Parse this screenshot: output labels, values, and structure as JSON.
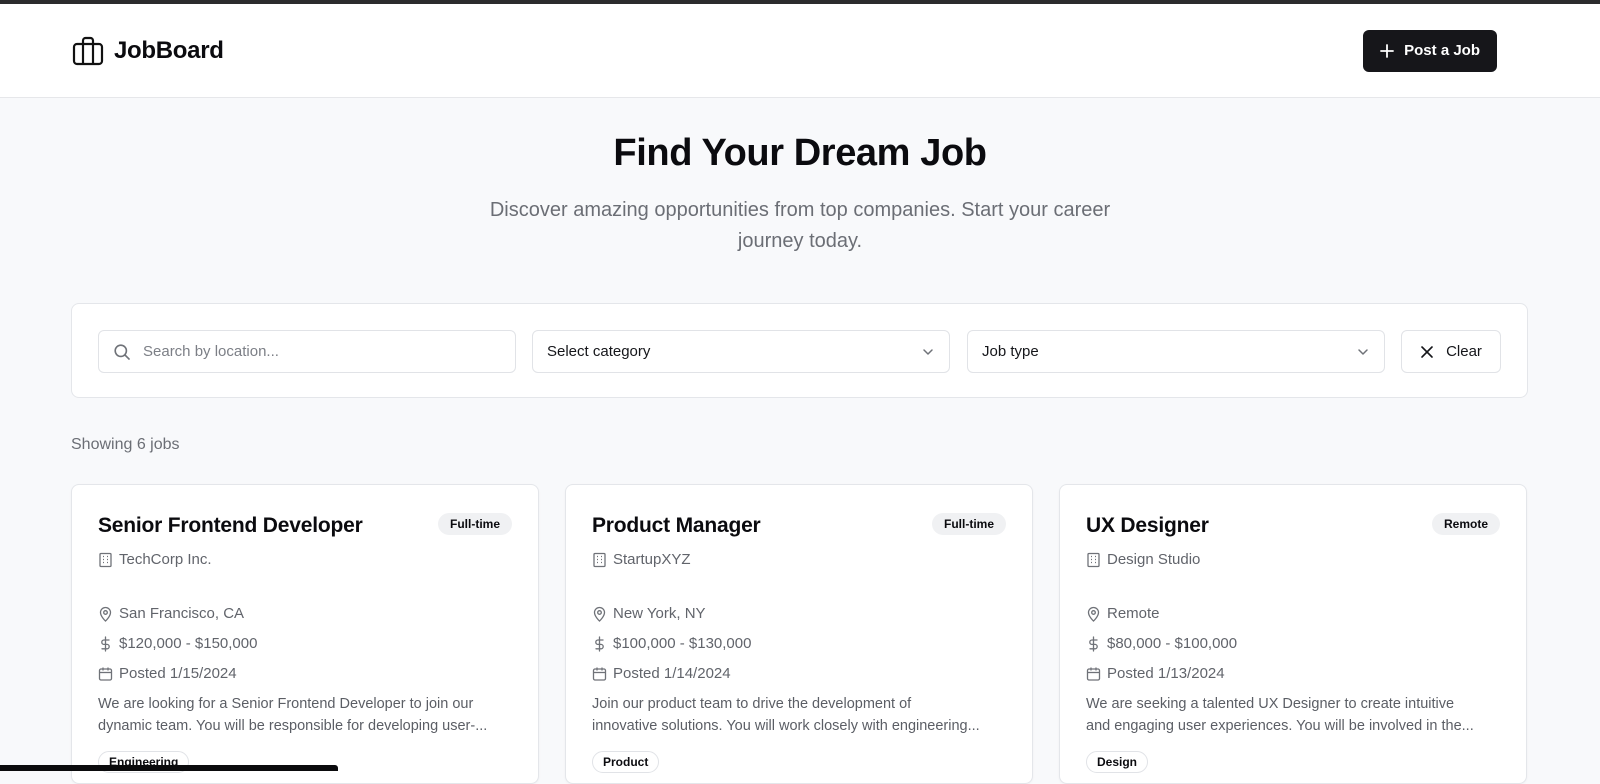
{
  "brand": {
    "name": "JobBoard",
    "icon": "briefcase-icon"
  },
  "header": {
    "post_button_label": "Post a Job",
    "post_button_icon": "plus-icon"
  },
  "hero": {
    "title": "Find Your Dream Job",
    "subtitle_line1": "Discover amazing opportunities from top companies. Start your career",
    "subtitle_line2": "journey today."
  },
  "filters": {
    "search_placeholder": "Search by location...",
    "category_value": "Select category",
    "job_type_value": "Job type",
    "clear_label": "Clear"
  },
  "results": {
    "showing_text": "Showing 6 jobs"
  },
  "jobs": [
    {
      "title": "Senior Frontend Developer",
      "type": "Full-time",
      "company": "TechCorp Inc.",
      "location": "San Francisco, CA",
      "salary": "$120,000 - $150,000",
      "posted": "Posted 1/15/2024",
      "desc_line1": "We are looking for a Senior Frontend Developer to join our",
      "desc_line2": "dynamic team. You will be responsible for developing user-...",
      "category": "Engineering"
    },
    {
      "title": "Product Manager",
      "type": "Full-time",
      "company": "StartupXYZ",
      "location": "New York, NY",
      "salary": "$100,000 - $130,000",
      "posted": "Posted 1/14/2024",
      "desc_line1": "Join our product team to drive the development of",
      "desc_line2": "innovative solutions. You will work closely with engineering...",
      "category": "Product"
    },
    {
      "title": "UX Designer",
      "type": "Remote",
      "company": "Design Studio",
      "location": "Remote",
      "salary": "$80,000 - $100,000",
      "posted": "Posted 1/13/2024",
      "desc_line1": "We are seeking a talented UX Designer to create intuitive",
      "desc_line2": "and engaging user experiences. You will be involved in the...",
      "category": "Design"
    }
  ],
  "colors": {
    "primary_button": "#16161a",
    "page_background": "#f8f9fb",
    "muted_text": "#6b6e75"
  }
}
